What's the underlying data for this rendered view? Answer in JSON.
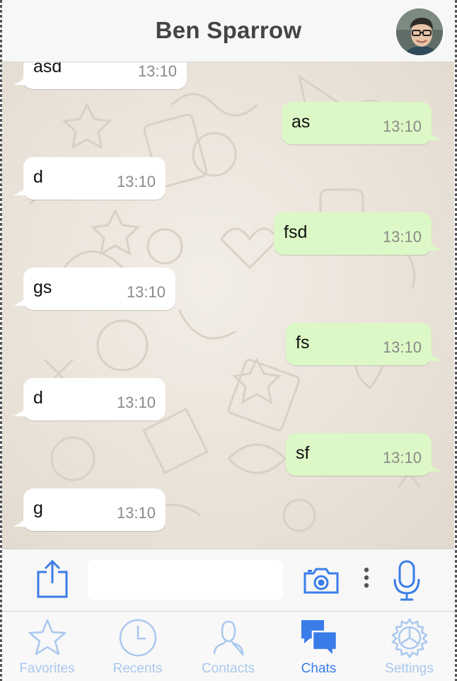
{
  "header": {
    "title": "Ben Sparrow"
  },
  "messages": [
    {
      "text": "asd",
      "time": "13:10",
      "direction": "incoming"
    },
    {
      "text": "as",
      "time": "13:10",
      "direction": "outgoing"
    },
    {
      "text": "d",
      "time": "13:10",
      "direction": "incoming"
    },
    {
      "text": "fsd",
      "time": "13:10",
      "direction": "outgoing"
    },
    {
      "text": "gs",
      "time": "13:10",
      "direction": "incoming"
    },
    {
      "text": "fs",
      "time": "13:10",
      "direction": "outgoing"
    },
    {
      "text": "d",
      "time": "13:10",
      "direction": "incoming"
    },
    {
      "text": "sf",
      "time": "13:10",
      "direction": "outgoing"
    },
    {
      "text": "g",
      "time": "13:10",
      "direction": "incoming"
    }
  ],
  "composer": {
    "input_value": "",
    "icons": [
      "share-icon",
      "camera-icon",
      "more-icon",
      "microphone-icon"
    ]
  },
  "tabbar": {
    "tabs": [
      {
        "label": "Favorites",
        "icon": "star-icon",
        "active": false
      },
      {
        "label": "Recents",
        "icon": "clock-icon",
        "active": false
      },
      {
        "label": "Contacts",
        "icon": "person-icon",
        "active": false
      },
      {
        "label": "Chats",
        "icon": "chat-bubbles-icon",
        "active": true
      },
      {
        "label": "Settings",
        "icon": "gear-icon",
        "active": false
      }
    ]
  },
  "colors": {
    "incoming_bubble": "#ffffff",
    "outgoing_bubble": "#dcf8c6",
    "tab_active": "#3a7de9",
    "tab_inactive": "#a9c8ee",
    "chat_background": "#ebe4da"
  }
}
